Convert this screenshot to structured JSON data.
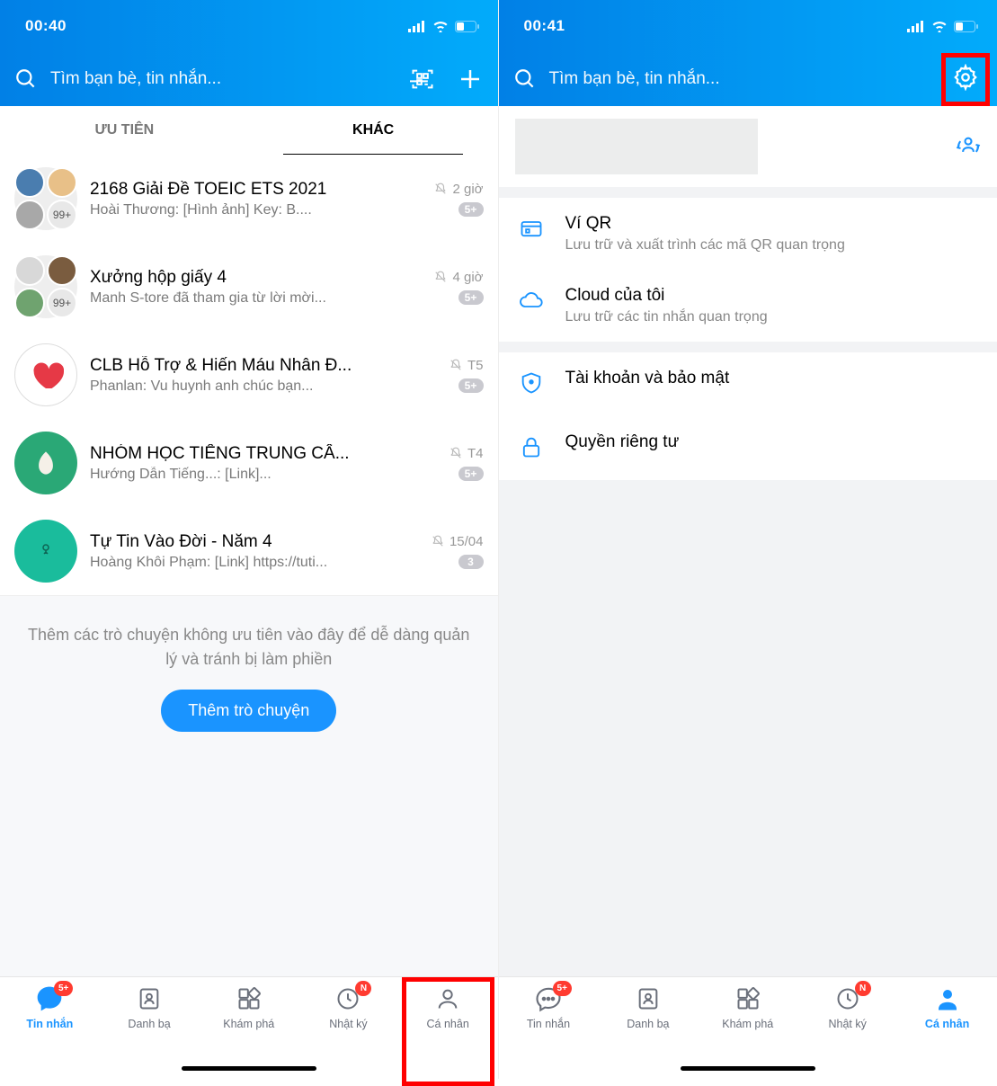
{
  "left": {
    "status": {
      "time": "00:40"
    },
    "header": {
      "placeholder": "Tìm bạn bè, tin nhắn..."
    },
    "tabs": {
      "priority": "ƯU TIÊN",
      "other": "KHÁC"
    },
    "chats": [
      {
        "title": "2168 Giải Đề TOEIC ETS 2021",
        "preview": "Hoài Thương: [Hình ảnh] Key: B....",
        "time": "2 giờ",
        "badge": "5+",
        "count": "99+"
      },
      {
        "title": "Xưởng hộp giấy 4",
        "preview": "Manh S-tore đã tham gia từ lời mời...",
        "time": "4 giờ",
        "badge": "5+",
        "count": "99+"
      },
      {
        "title": "CLB Hỗ Trợ & Hiến Máu Nhân Đ...",
        "preview": "Phanlan: Vu huynh anh chúc bạn...",
        "time": "T5",
        "badge": "5+"
      },
      {
        "title": "NHÓM HỌC TIẾNG TRUNG CẤ...",
        "preview": "Hướng Dẫn Tiếng...: [Link]...",
        "time": "T4",
        "badge": "5+"
      },
      {
        "title": "Tự Tin Vào Đời - Năm 4",
        "preview": "Hoàng Khôi Phạm: [Link] https://tuti...",
        "time": "15/04",
        "badge": "3"
      }
    ],
    "promo": {
      "text": "Thêm các trò chuyện không ưu tiên vào đây để dễ dàng quản lý và tránh bị làm phiền",
      "button": "Thêm trò chuyện"
    },
    "nav": [
      {
        "label": "Tin nhắn",
        "badge": "5+"
      },
      {
        "label": "Danh bạ"
      },
      {
        "label": "Khám phá"
      },
      {
        "label": "Nhật ký",
        "badge": "N"
      },
      {
        "label": "Cá nhân"
      }
    ]
  },
  "right": {
    "status": {
      "time": "00:41"
    },
    "header": {
      "placeholder": "Tìm bạn bè, tin nhắn..."
    },
    "menu": [
      {
        "title": "Ví QR",
        "subtitle": "Lưu trữ và xuất trình các mã QR quan trọng"
      },
      {
        "title": "Cloud của tôi",
        "subtitle": "Lưu trữ các tin nhắn quan trọng"
      },
      {
        "title": "Tài khoản và bảo mật"
      },
      {
        "title": "Quyền riêng tư"
      }
    ],
    "nav": [
      {
        "label": "Tin nhắn",
        "badge": "5+"
      },
      {
        "label": "Danh bạ"
      },
      {
        "label": "Khám phá"
      },
      {
        "label": "Nhật ký",
        "badge": "N"
      },
      {
        "label": "Cá nhân"
      }
    ]
  }
}
